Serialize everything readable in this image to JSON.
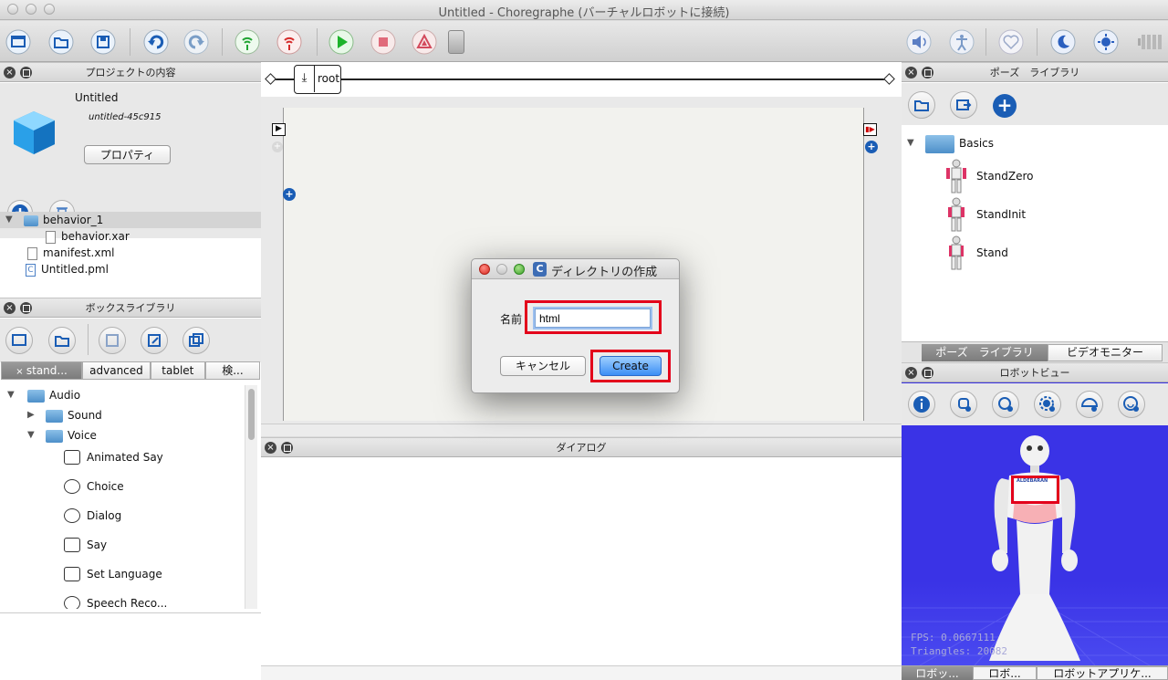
{
  "window": {
    "title": "Untitled - Choregraphe (バーチャルロボットに接続)"
  },
  "toolbar": {
    "buttons": [
      "new-project",
      "open-project",
      "save-project",
      "undo",
      "redo",
      "connect",
      "disconnect",
      "play",
      "stop",
      "debug",
      "volume",
      "animation-mode",
      "heart",
      "rest",
      "wake-up",
      "battery"
    ]
  },
  "project_panel": {
    "title": "プロジェクトの内容",
    "project_name": "Untitled",
    "project_id": "untitled-45c915",
    "properties_button": "プロパティ",
    "tree": [
      {
        "label": "behavior_1",
        "kind": "folder",
        "depth": 0,
        "expanded": true
      },
      {
        "label": "behavior.xar",
        "kind": "file",
        "depth": 1
      },
      {
        "label": "manifest.xml",
        "kind": "file",
        "depth": 0
      },
      {
        "label": "Untitled.pml",
        "kind": "pml",
        "depth": 0
      }
    ]
  },
  "box_library": {
    "title": "ボックスライブラリ",
    "tabs": [
      "stand...",
      "advanced",
      "tablet",
      "検..."
    ],
    "tree": [
      {
        "label": "Audio",
        "depth": 0,
        "expanded": true
      },
      {
        "label": "Sound",
        "depth": 1,
        "expanded": false
      },
      {
        "label": "Voice",
        "depth": 1,
        "expanded": true
      }
    ],
    "boxes": [
      "Animated Say",
      "Choice",
      "Dialog",
      "Say",
      "Set Language",
      "Speech Reco..."
    ]
  },
  "flow": {
    "breadcrumb": "root"
  },
  "dialog_panel": {
    "title": "ダイアログ"
  },
  "pose_panel": {
    "title": "ポーズ　ライブラリ",
    "folder": "Basics",
    "poses": [
      "StandZero",
      "StandInit",
      "Stand"
    ],
    "tabs": [
      "ポーズ　ライブラリ",
      "ビデオモニター"
    ]
  },
  "robot_view": {
    "title": "ロボットビュー",
    "fps": "FPS: 0.0667111",
    "triangles": "Triangles: 20082",
    "chest_logo": "ALDEBARAN",
    "bottom_tabs": [
      "ロボッ...",
      "ロボ...",
      "ロボットアプリケ..."
    ]
  },
  "modal": {
    "title": "ディレクトリの作成",
    "name_label": "名前",
    "name_value": "html",
    "cancel": "キャンセル",
    "create": "Create"
  }
}
